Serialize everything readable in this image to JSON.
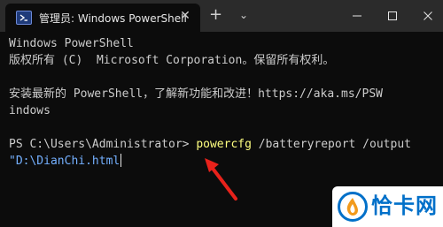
{
  "window": {
    "tab_title": "管理员: Windows PowerShell",
    "close_tab_glyph": "✕",
    "new_tab_glyph": "+",
    "dropdown_glyph": "⌄",
    "minimize_glyph": "—",
    "maximize_glyph": "☐",
    "close_glyph": "✕",
    "app_icon": "powershell-icon"
  },
  "terminal": {
    "lines": [
      "Windows PowerShell",
      "版权所有 (C)  Microsoft Corporation。保留所有权利。",
      "",
      "安装最新的 PowerShell，了解新功能和改进！https://aka.ms/PSW",
      "indows",
      ""
    ],
    "prompt": "PS C:\\Users\\Administrator>",
    "command": "powercfg",
    "args": "/batteryreport /output",
    "path_line": "\"D:\\DianChi.html"
  },
  "annotation": {
    "arrow_color": "#e8221b"
  },
  "watermark": {
    "text": "恰卡网",
    "brand_color": "#0070c9"
  }
}
